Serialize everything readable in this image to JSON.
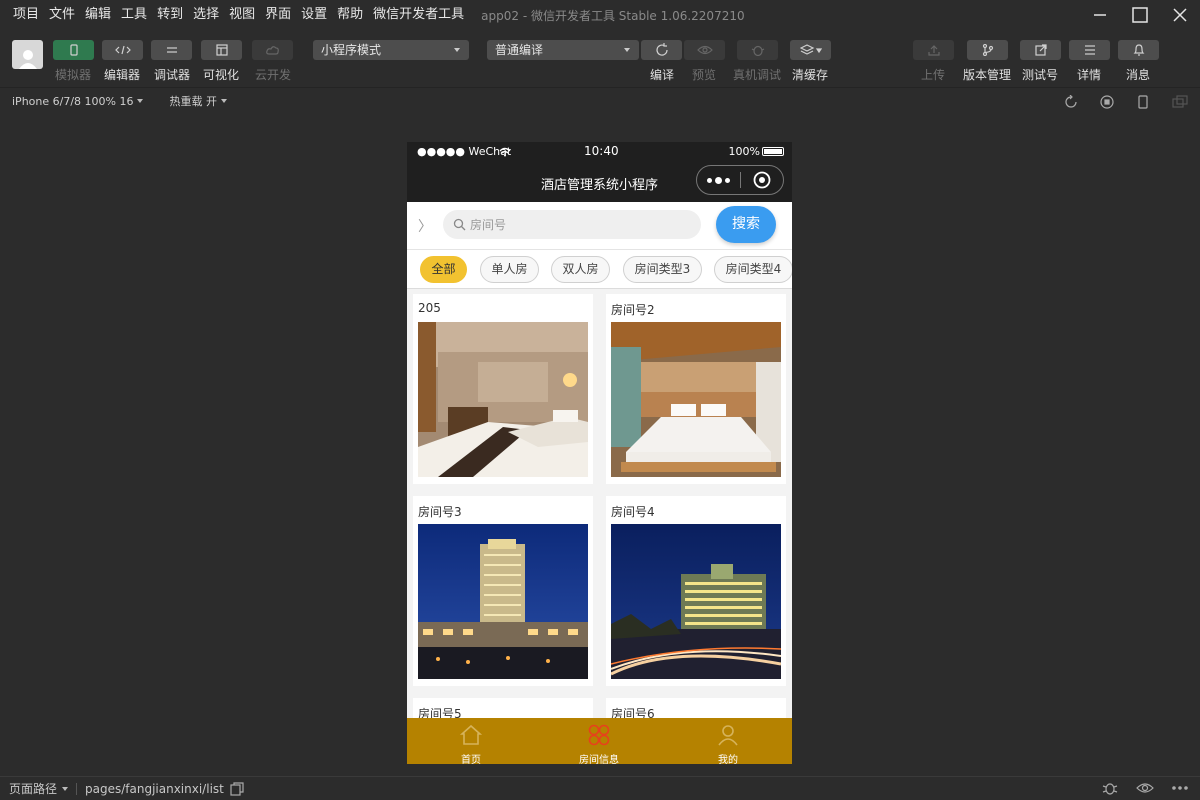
{
  "menubar": {
    "items": [
      "项目",
      "文件",
      "编辑",
      "工具",
      "转到",
      "选择",
      "视图",
      "界面",
      "设置",
      "帮助",
      "微信开发者工具"
    ],
    "title": "app02 - 微信开发者工具 Stable 1.06.2207210"
  },
  "toolbar": {
    "simulator": "模拟器",
    "editor": "编辑器",
    "debugger": "调试器",
    "visual": "可视化",
    "cloud": "云开发",
    "mode_select": "小程序模式",
    "compile_select": "普通编译",
    "compile": "编译",
    "preview": "预览",
    "remote_debug": "真机调试",
    "clear_cache": "清缓存",
    "upload": "上传",
    "version": "版本管理",
    "test_account": "测试号",
    "details": "详情",
    "messages": "消息"
  },
  "subbar": {
    "device": "iPhone 6/7/8 100% 16",
    "hot_reload": "热重载 开"
  },
  "phone": {
    "status": {
      "carrier": "●●●●● WeChat",
      "time": "10:40",
      "battery": "100%"
    },
    "nav_title": "酒店管理系统小程序",
    "search": {
      "placeholder": "房间号",
      "button": "搜索"
    },
    "filters": [
      "全部",
      "单人房",
      "双人房",
      "房间类型3",
      "房间类型4"
    ],
    "cards": [
      "205",
      "房间号2",
      "房间号3",
      "房间号4",
      "房间号5",
      "房间号6"
    ],
    "tabs": [
      "首页",
      "房间信息",
      "我的"
    ]
  },
  "bottombar": {
    "path_label": "页面路径",
    "path": "pages/fangjianxinxi/list"
  },
  "colors": {
    "accent_blue": "#3a9cf0",
    "chip_active": "#f2c230",
    "tabbar": "#b58200",
    "tab_active": "#e8401c"
  }
}
